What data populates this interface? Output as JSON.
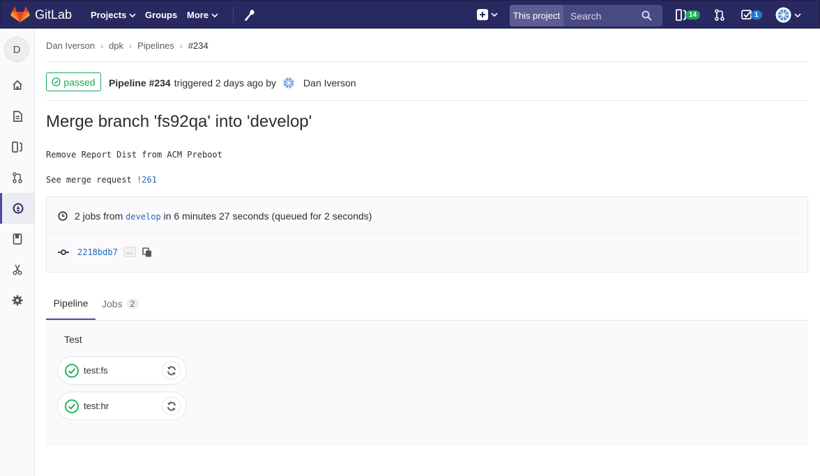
{
  "navbar": {
    "brand": "GitLab",
    "projects_label": "Projects",
    "groups_label": "Groups",
    "more_label": "More",
    "search_scope": "This project",
    "search_placeholder": "Search",
    "issues_count": "14",
    "todos_count": "1",
    "colors": {
      "background": "#292961",
      "issues_badge": "#1aaa55",
      "todos_badge": "#1f78d1"
    }
  },
  "sidebar": {
    "project_avatar": "D",
    "items": [
      "home-icon",
      "repository-icon",
      "issues-icon",
      "merge-requests-icon",
      "ci-cd-icon",
      "wiki-icon",
      "snippets-icon",
      "settings-icon"
    ],
    "active_item": "ci-cd-icon"
  },
  "breadcrumb": [
    "Dan Iverson",
    "dpk",
    "Pipelines",
    "#234"
  ],
  "pipeline": {
    "status": "passed",
    "status_color": "#1aaa55",
    "title": "Pipeline #234",
    "triggered_text": "triggered 2 days ago by",
    "user": "Dan Iverson"
  },
  "commit": {
    "title": "Merge branch 'fs92qa' into 'develop'",
    "description_line": "Remove Report Dist from ACM Preboot",
    "merge_request_prefix": "See merge request",
    "merge_request_ref": "!261"
  },
  "info": {
    "jobs_text": "2 jobs from",
    "branch": "develop",
    "duration_text": "in 6 minutes 27 seconds (queued for 2 seconds)",
    "sha": "2218bdb7",
    "ellipsis": "..."
  },
  "tabs": [
    {
      "label": "Pipeline",
      "active": true
    },
    {
      "label": "Jobs",
      "count": "2",
      "active": false
    }
  ],
  "stages": [
    {
      "name": "Test",
      "jobs": [
        {
          "name": "test:fs",
          "status": "success"
        },
        {
          "name": "test:hr",
          "status": "success"
        }
      ]
    }
  ]
}
